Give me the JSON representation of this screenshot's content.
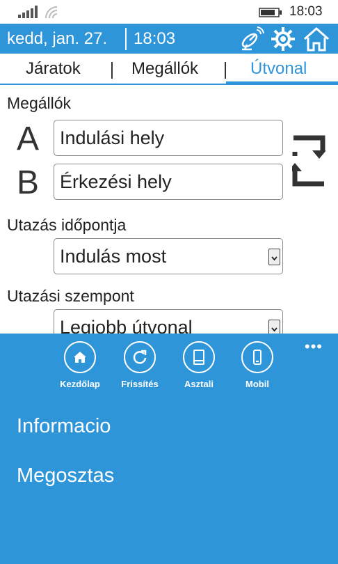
{
  "status": {
    "time": "18:03"
  },
  "header": {
    "date": "kedd, jan. 27.",
    "time": "18:03"
  },
  "tabs": [
    {
      "label": "Járatok",
      "active": false
    },
    {
      "label": "Megállók",
      "active": false
    },
    {
      "label": "Útvonal",
      "active": true
    }
  ],
  "form": {
    "stops_label": "Megállók",
    "a_letter": "A",
    "b_letter": "B",
    "from_placeholder": "Indulási hely",
    "to_placeholder": "Érkezési hely",
    "time_label": "Utazás időpontja",
    "time_value": "Indulás most",
    "criterion_label": "Utazási szempont",
    "criterion_value": "Legjobb útvonal"
  },
  "appbar": {
    "more": "•••",
    "buttons": [
      {
        "label": "Kezdőlap",
        "icon": "home-icon"
      },
      {
        "label": "Frissítés",
        "icon": "refresh-icon"
      },
      {
        "label": "Asztali",
        "icon": "tablet-icon"
      },
      {
        "label": "Mobil",
        "icon": "phone-icon"
      }
    ],
    "menu": [
      "Informacio",
      "Megosztas"
    ]
  },
  "colors": {
    "accent": "#2f95d9"
  }
}
